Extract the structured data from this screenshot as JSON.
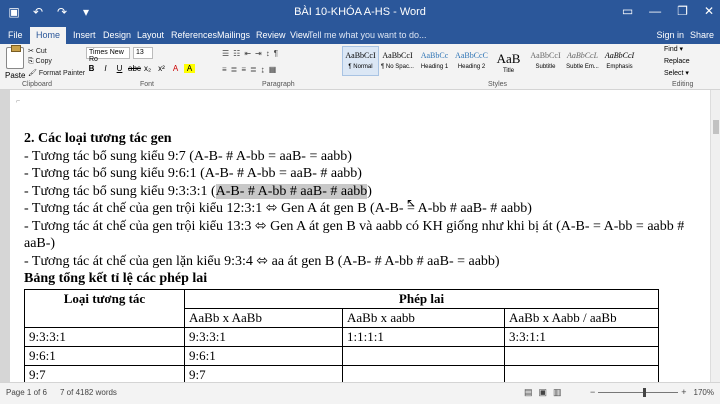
{
  "window": {
    "title": "BÀI 10-KHÓA A-HS - Word",
    "qat": [
      "save-icon",
      "undo-icon",
      "redo-icon",
      "customize-icon"
    ],
    "controls": {
      "options": "▭",
      "minimize": "—",
      "restore": "❐",
      "close": "✕"
    }
  },
  "tabs": [
    {
      "label": "File"
    },
    {
      "label": "Home"
    },
    {
      "label": "Insert"
    },
    {
      "label": "Design"
    },
    {
      "label": "Layout"
    },
    {
      "label": "References"
    },
    {
      "label": "Mailings"
    },
    {
      "label": "Review"
    },
    {
      "label": "View"
    }
  ],
  "tellme": "Tell me what you want to do...",
  "signin": "Sign in",
  "share": "Share",
  "clipboard": {
    "paste": "Paste",
    "cut": "Cut",
    "copy": "Copy",
    "format_painter": "Format Painter",
    "label": "Clipboard"
  },
  "font": {
    "name": "Times New Ro",
    "size": "13",
    "buttons": [
      "B",
      "I",
      "U",
      "abc",
      "x₂",
      "x²",
      "A",
      "A"
    ],
    "label": "Font"
  },
  "paragraph": {
    "label": "Paragraph",
    "row1": [
      "☰",
      "☷",
      "⇤",
      "⇥",
      "↕",
      "¶"
    ],
    "row2": [
      "≡",
      "≣",
      "≡",
      "≣",
      "↨",
      "▦"
    ]
  },
  "styles": {
    "label": "Styles",
    "items": [
      {
        "sample": "AaBbCcI",
        "name": "¶ Normal"
      },
      {
        "sample": "AaBbCcI",
        "name": "¶ No Spac..."
      },
      {
        "sample": "AaBbCc",
        "name": "Heading 1"
      },
      {
        "sample": "AaBbCcC",
        "name": "Heading 2"
      },
      {
        "sample": "AaB",
        "name": "Title"
      },
      {
        "sample": "AaBbCcI",
        "name": "Subtitle"
      },
      {
        "sample": "AaBbCcL",
        "name": "Subtle Em..."
      },
      {
        "sample": "AaBbCcI",
        "name": "Emphasis"
      }
    ]
  },
  "editing": {
    "find": "Find ▾",
    "replace": "Replace",
    "select": "Select ▾",
    "label": "Editing"
  },
  "document": {
    "heading": "2. Các loại tương tác gen",
    "lines": [
      "- Tương tác bổ sung kiểu 9:7 (A-B- # A-bb = aaB- = aabb)",
      "- Tương tác bổ sung kiểu 9:6:1 (A-B- # A-bb = aaB- # aabb)",
      "- Tương tác bổ sung kiểu 9:3:3:1 (",
      "A-B- # A-bb # aaB- # aabb",
      ")",
      "- Tương tác át chế của gen trội kiểu 12:3:1 ⬄ Gen A át gen B (A-B- = A-bb # aaB- # aabb)",
      "- Tương tác át chế của gen trội kiểu 13:3 ⬄ Gen A át gen B và aabb có KH giống như khi bị át (A-B- = A-bb = aabb # aaB-)",
      "- Tương tác át chế của gen lặn kiểu 9:3:4 ⬄ aa át gen B (A-B- # A-bb # aaB- = aabb)"
    ],
    "table_title": "Bảng tổng kết tỉ lệ các phép lai",
    "table": {
      "col1": "Loại tương tác",
      "col2": "Phép lai",
      "sub": [
        "AaBb x AaBb",
        "AaBb x aabb",
        "AaBb x Aabb / aaBb"
      ],
      "rows": [
        [
          "9:3:3:1",
          "9:3:3:1",
          "1:1:1:1",
          "3:3:1:1"
        ],
        [
          "9:6:1",
          "9:6:1",
          "",
          ""
        ],
        [
          "9:7",
          "9:7",
          "",
          ""
        ]
      ]
    }
  },
  "status": {
    "page": "Page 1 of 6",
    "words": "7 of 4182 words",
    "zoom": "170%",
    "zoom_level": 0.58
  }
}
